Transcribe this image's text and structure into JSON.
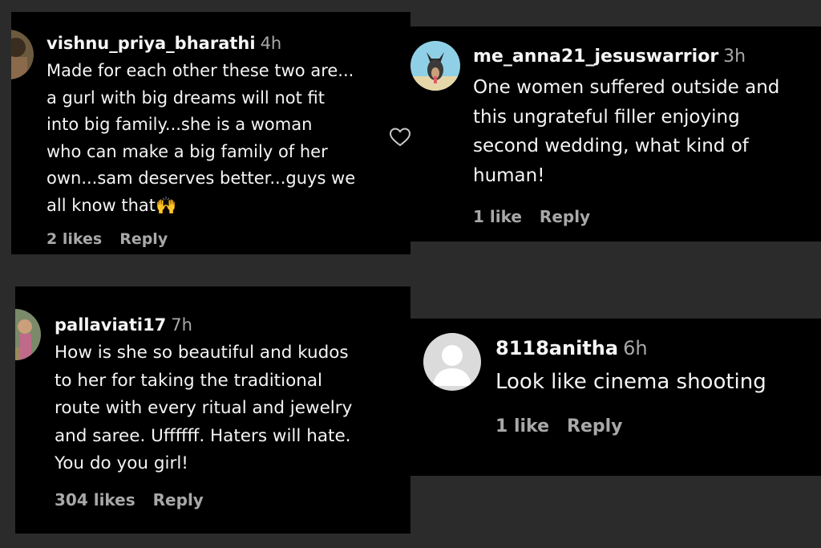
{
  "colors": {
    "background": "#2b2b2b",
    "card": "#000000",
    "text": "#f5f5f5",
    "muted": "#a8a8a8"
  },
  "comments": [
    {
      "username": "vishnu_priya_bharathi",
      "time": "4h",
      "lines": [
        "Made for each other these two are...",
        "a gurl with big dreams will not fit",
        "into big family...she is a woman",
        "who can make a big family of her",
        "own...sam deserves better...guys we",
        "all know that🙌"
      ],
      "likes": "2 likes",
      "reply": "Reply",
      "icon": "heart-outline-icon"
    },
    {
      "username": "me_anna21_jesuswarrior",
      "time": "3h",
      "lines": [
        "One women suffered outside and",
        "this ungrateful filler enjoying",
        "second wedding, what kind of",
        "human!"
      ],
      "likes": "1 like",
      "reply": "Reply"
    },
    {
      "username": "pallaviati17",
      "time": "7h",
      "lines": [
        "How is she so beautiful and kudos",
        "to her for taking the traditional",
        "route with every ritual and jewelry",
        "and saree. Uffffff. Haters will hate.",
        "You do you girl!"
      ],
      "likes": "304 likes",
      "reply": "Reply"
    },
    {
      "username": "8118anitha",
      "time": "6h",
      "lines": [
        "Look like cinema shooting"
      ],
      "likes": "1 like",
      "reply": "Reply"
    }
  ]
}
